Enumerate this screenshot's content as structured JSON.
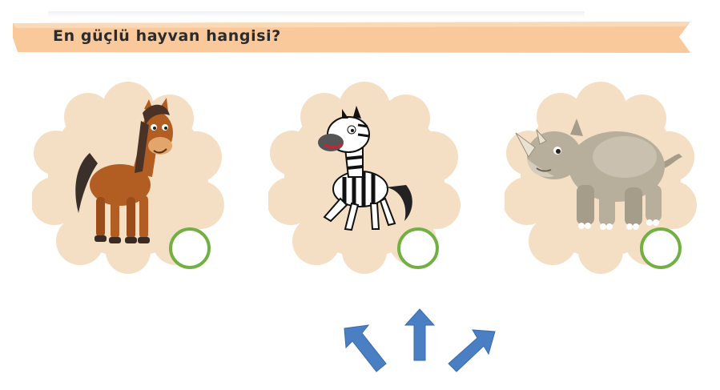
{
  "header": {
    "question": "En güçlü hayvan hangisi?",
    "banner_color": "#f9c99c"
  },
  "options": [
    {
      "animal": "horse",
      "icon": "horse-illustration",
      "selected": false
    },
    {
      "animal": "zebra",
      "icon": "zebra-illustration",
      "selected": false
    },
    {
      "animal": "rhino",
      "icon": "rhino-illustration",
      "selected": false
    }
  ],
  "colors": {
    "blob": "#f4dfc4",
    "answer_circle": "#72b043",
    "arrow": "#4a7fc4"
  },
  "arrows": [
    {
      "icon": "arrow-up-left-icon"
    },
    {
      "icon": "arrow-up-icon"
    },
    {
      "icon": "arrow-up-right-icon"
    }
  ]
}
